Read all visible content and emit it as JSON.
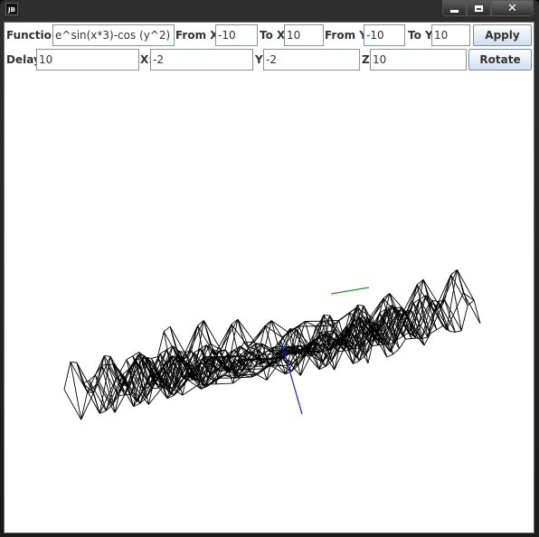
{
  "window": {
    "icon_text": "JB",
    "controls": {
      "minimize": "minimize-icon",
      "maximize": "maximize-icon",
      "close": "✕"
    }
  },
  "controls": {
    "function_label": "Function:",
    "function_value": "e^sin(x*3)-cos (y^2)",
    "from_x_label": "From X:",
    "from_x_value": "-10",
    "to_x_label": "To X:",
    "to_x_value": "10",
    "from_y_label": "From Y:",
    "from_y_value": "-10",
    "to_y_label": "To Y:",
    "to_y_value": "10",
    "apply_label": "Apply",
    "delay_label": "Delay:",
    "delay_value": "10",
    "x_label": "X:",
    "x_value": "-2",
    "y_label": "Y:",
    "y_value": "-2",
    "z_label": "Z:",
    "z_value": "10",
    "rotate_label": "Rotate"
  },
  "plot": {
    "mesh_color": "#000000",
    "axis_colors": {
      "vertical": "#1a1acc",
      "secondary": "#2a8a2a"
    }
  }
}
